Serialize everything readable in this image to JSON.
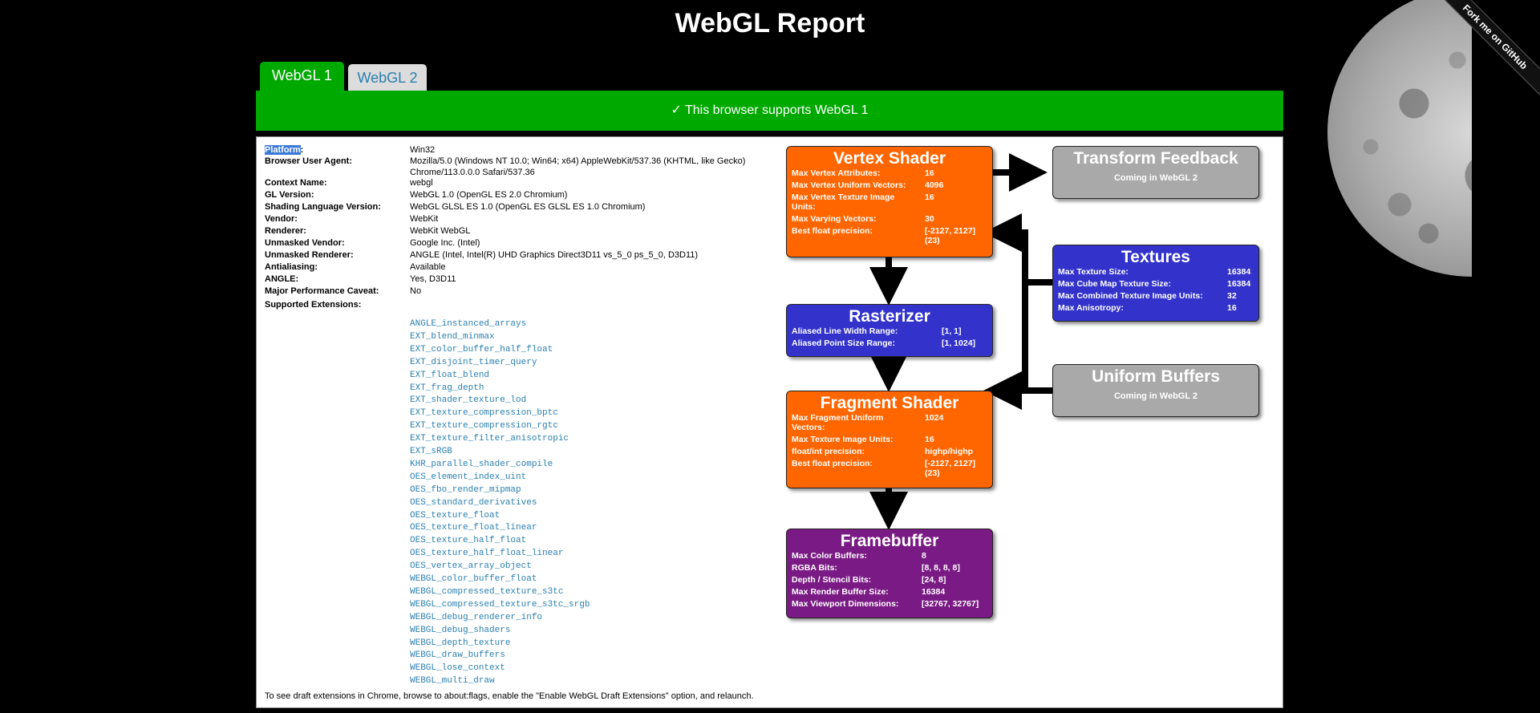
{
  "page": {
    "title": "WebGL Report",
    "ribbon": "Fork me on GitHub"
  },
  "tabs": [
    {
      "label": "WebGL 1",
      "active": true
    },
    {
      "label": "WebGL 2",
      "active": false
    }
  ],
  "banner": "✓ This browser supports WebGL 1",
  "info": [
    {
      "key": "Platform",
      "sep": ":",
      "value": "Win32"
    },
    {
      "key": "Browser User Agent:",
      "value": "Mozilla/5.0 (Windows NT 10.0; Win64; x64) AppleWebKit/537.36 (KHTML, like Gecko) Chrome/113.0.0.0 Safari/537.36"
    },
    {
      "key": "Context Name:",
      "value": "webgl"
    },
    {
      "key": "GL Version:",
      "value": "WebGL 1.0 (OpenGL ES 2.0 Chromium)"
    },
    {
      "key": "Shading Language Version:",
      "value": "WebGL GLSL ES 1.0 (OpenGL ES GLSL ES 1.0 Chromium)"
    },
    {
      "key": "Vendor:",
      "value": "WebKit"
    },
    {
      "key": "Renderer:",
      "value": "WebKit WebGL"
    },
    {
      "key": "Unmasked Vendor:",
      "value": "Google Inc. (Intel)"
    },
    {
      "key": "Unmasked Renderer:",
      "value": "ANGLE (Intel, Intel(R) UHD Graphics Direct3D11 vs_5_0 ps_5_0, D3D11)"
    },
    {
      "key": "Antialiasing:",
      "value": "Available"
    },
    {
      "key": "ANGLE:",
      "value": "Yes, D3D11"
    },
    {
      "key": "Major Performance Caveat:",
      "value": "No"
    },
    {
      "key": "Supported Extensions:",
      "value": ""
    }
  ],
  "extensions": [
    "ANGLE_instanced_arrays",
    "EXT_blend_minmax",
    "EXT_color_buffer_half_float",
    "EXT_disjoint_timer_query",
    "EXT_float_blend",
    "EXT_frag_depth",
    "EXT_shader_texture_lod",
    "EXT_texture_compression_bptc",
    "EXT_texture_compression_rgtc",
    "EXT_texture_filter_anisotropic",
    "EXT_sRGB",
    "KHR_parallel_shader_compile",
    "OES_element_index_uint",
    "OES_fbo_render_mipmap",
    "OES_standard_derivatives",
    "OES_texture_float",
    "OES_texture_float_linear",
    "OES_texture_half_float",
    "OES_texture_half_float_linear",
    "OES_vertex_array_object",
    "WEBGL_color_buffer_float",
    "WEBGL_compressed_texture_s3tc",
    "WEBGL_compressed_texture_s3tc_srgb",
    "WEBGL_debug_renderer_info",
    "WEBGL_debug_shaders",
    "WEBGL_depth_texture",
    "WEBGL_draw_buffers",
    "WEBGL_lose_context",
    "WEBGL_multi_draw"
  ],
  "footnote": "To see draft extensions in Chrome, browse to about:flags, enable the \"Enable WebGL Draft Extensions\" option, and relaunch.",
  "pipeline": {
    "vertex_shader": {
      "title": "Vertex Shader",
      "rows": [
        {
          "k": "Max Vertex Attributes:",
          "v": "16"
        },
        {
          "k": "Max Vertex Uniform Vectors:",
          "v": "4096"
        },
        {
          "k": "Max Vertex Texture Image Units:",
          "v": "16"
        },
        {
          "k": "Max Varying Vectors:",
          "v": "30"
        },
        {
          "k": "Best float precision:",
          "v": "[-2127, 2127] (23)"
        }
      ]
    },
    "rasterizer": {
      "title": "Rasterizer",
      "rows": [
        {
          "k": "Aliased Line Width Range:",
          "v": "[1, 1]"
        },
        {
          "k": "Aliased Point Size Range:",
          "v": "[1, 1024]"
        }
      ]
    },
    "fragment_shader": {
      "title": "Fragment Shader",
      "rows": [
        {
          "k": "Max Fragment Uniform Vectors:",
          "v": "1024"
        },
        {
          "k": "Max Texture Image Units:",
          "v": "16"
        },
        {
          "k": "float/int precision:",
          "v": "highp/highp"
        },
        {
          "k": "Best float precision:",
          "v": "[-2127, 2127] (23)"
        }
      ]
    },
    "framebuffer": {
      "title": "Framebuffer",
      "rows": [
        {
          "k": "Max Color Buffers:",
          "v": "8"
        },
        {
          "k": "RGBA Bits:",
          "v": "[8, 8, 8, 8]"
        },
        {
          "k": "Depth / Stencil Bits:",
          "v": "[24, 8]"
        },
        {
          "k": "Max Render Buffer Size:",
          "v": "16384"
        },
        {
          "k": "Max Viewport Dimensions:",
          "v": "[32767, 32767]"
        }
      ]
    },
    "transform_feedback": {
      "title": "Transform Feedback",
      "subtitle": "Coming in WebGL 2"
    },
    "textures": {
      "title": "Textures",
      "rows": [
        {
          "k": "Max Texture Size:",
          "v": "16384"
        },
        {
          "k": "Max Cube Map Texture Size:",
          "v": "16384"
        },
        {
          "k": "Max Combined Texture Image Units:",
          "v": "32"
        },
        {
          "k": "Max Anisotropy:",
          "v": "16"
        }
      ]
    },
    "uniform_buffers": {
      "title": "Uniform Buffers",
      "subtitle": "Coming in WebGL 2"
    }
  },
  "colors": {
    "accent_green": "#00a900",
    "shader_orange": "#ff6600",
    "stage_blue": "#3333cc",
    "framebuffer_purple": "#7a1a84",
    "future_gray": "#a9a9a9",
    "link_blue": "#2a7fb0"
  }
}
